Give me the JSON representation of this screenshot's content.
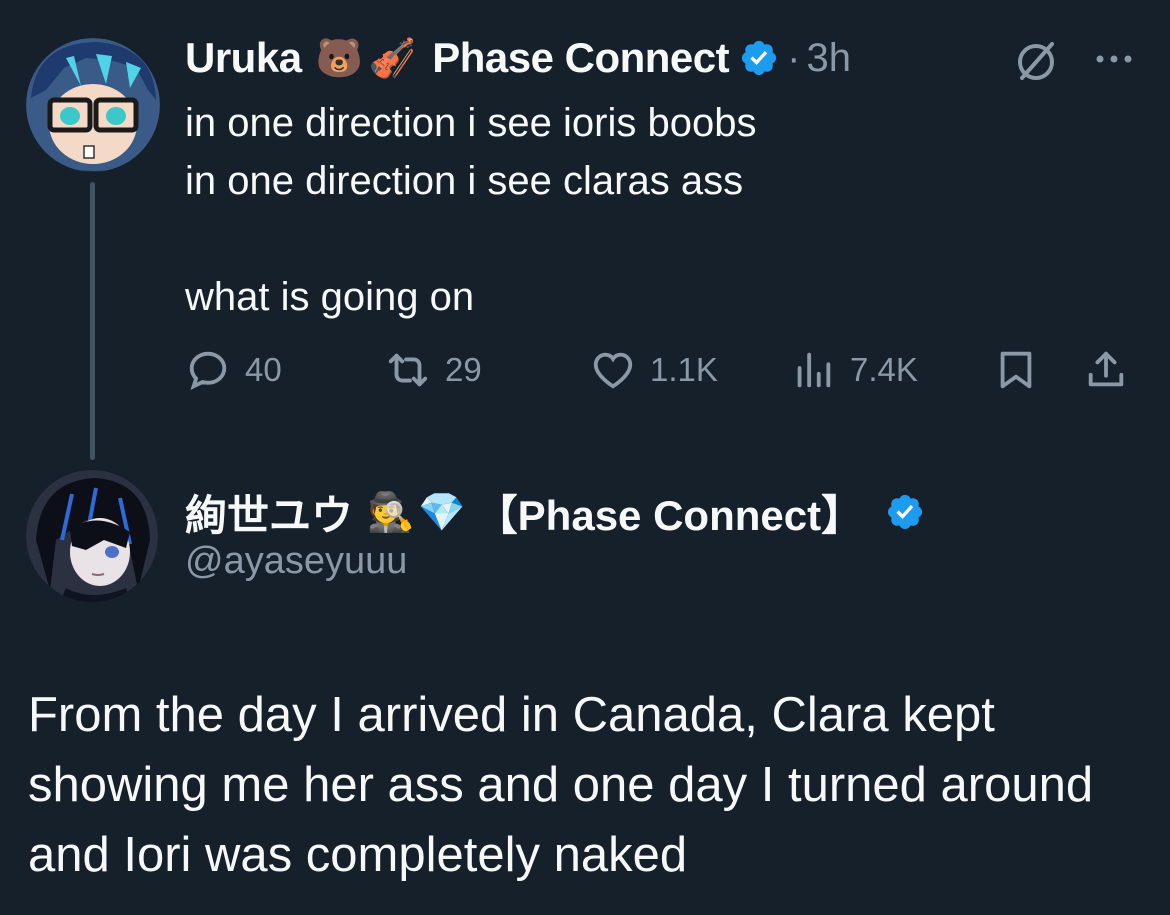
{
  "tweet1": {
    "display_name": "Uruka",
    "name_emojis": [
      "🐻",
      "🎻"
    ],
    "affiliation": "Phase Connect",
    "separator": "·",
    "time": "3h",
    "text": "in one direction i see ioris boobs\nin one direction i see claras ass\n\nwhat is going on",
    "actions": {
      "replies": "40",
      "reposts": "29",
      "likes": "1.1K",
      "views": "7.4K"
    }
  },
  "tweet2": {
    "display_name": "絢世ユウ",
    "name_emojis": [
      "🕵",
      "💎"
    ],
    "affiliation": "【Phase Connect】",
    "handle": "@ayaseyuuu",
    "text": "From the day I arrived in Canada, Clara kept showing me her ass and one day I turned around and Iori was completely naked"
  },
  "colors": {
    "background": "#15202b",
    "text_primary": "#f7f9f9",
    "text_secondary": "#8b98a5",
    "verified_blue": "#1d9bf0",
    "thread_line": "#425364"
  },
  "icons": [
    "verified-badge-icon",
    "grok-icon",
    "more-icon",
    "reply-icon",
    "repost-icon",
    "like-icon",
    "views-icon",
    "bookmark-icon",
    "share-icon"
  ]
}
